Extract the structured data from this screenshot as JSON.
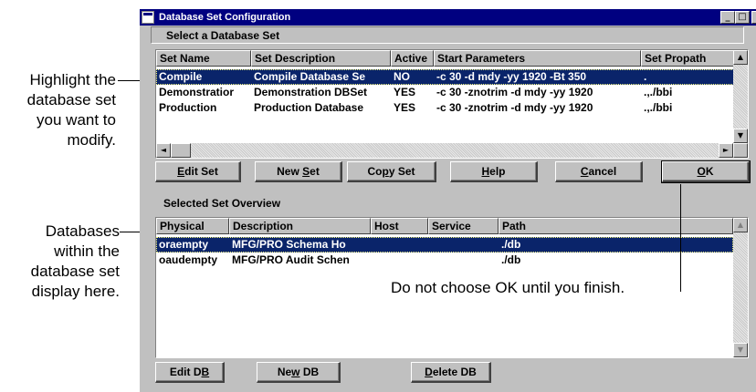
{
  "callouts": {
    "highlight": [
      "Highlight the",
      "database set",
      "you want to",
      "modify."
    ],
    "databases": [
      "Databases",
      "within the",
      "database set",
      "display here."
    ],
    "ok_note": "Do not choose OK until you finish."
  },
  "window": {
    "title": "Database Set Configuration",
    "controls": {
      "minimize": "_",
      "maximize": "□",
      "close": "×"
    }
  },
  "select_group_label": "Select a Database Set",
  "sets": {
    "columns": [
      "Set Name",
      "Set Description",
      "Active",
      "Start Parameters",
      "Set Propath"
    ],
    "rows": [
      [
        "Compile",
        "Compile Database Se",
        "NO",
        "-c 30 -d mdy -yy 1920 -Bt 350",
        "."
      ],
      [
        "Demonstratior",
        "Demonstration DBSet",
        "YES",
        "-c 30 -znotrim -d mdy -yy 1920",
        ".,./bbi"
      ],
      [
        "Production",
        "Production Database",
        "YES",
        "-c 30 -znotrim -d mdy -yy 1920",
        ".,./bbi"
      ]
    ],
    "selected_index": 0
  },
  "set_buttons": {
    "edit": {
      "pre": "",
      "key": "E",
      "post": "dit Set"
    },
    "new": {
      "pre": "New ",
      "key": "S",
      "post": "et"
    },
    "copy": {
      "pre": "Co",
      "key": "p",
      "post": "y Set"
    },
    "help": {
      "pre": "",
      "key": "H",
      "post": "elp"
    },
    "cancel": {
      "pre": "",
      "key": "C",
      "post": "ancel"
    },
    "ok": {
      "pre": "",
      "key": "O",
      "post": "K"
    }
  },
  "overview_label": "Selected Set Overview",
  "databases": {
    "columns": [
      "Physical",
      "Description",
      "Host",
      "Service",
      "Path"
    ],
    "rows": [
      [
        "oraempty",
        "MFG/PRO Schema Ho",
        "",
        "",
        "./db"
      ],
      [
        "oaudempty",
        "MFG/PRO Audit Schen",
        "",
        "",
        "./db"
      ]
    ],
    "selected_index": 0
  },
  "db_buttons": {
    "edit": {
      "pre": "Edit D",
      "key": "B",
      "post": ""
    },
    "new": {
      "pre": "Ne",
      "key": "w",
      "post": " DB"
    },
    "delete": {
      "pre": "",
      "key": "D",
      "post": "elete DB"
    }
  },
  "scroll_glyphs": {
    "up": "▲",
    "down": "▼",
    "left": "◄",
    "right": "►"
  },
  "colors": {
    "title_bar": "#000080",
    "selection": "#0a246a",
    "face": "#c0c0c0"
  }
}
